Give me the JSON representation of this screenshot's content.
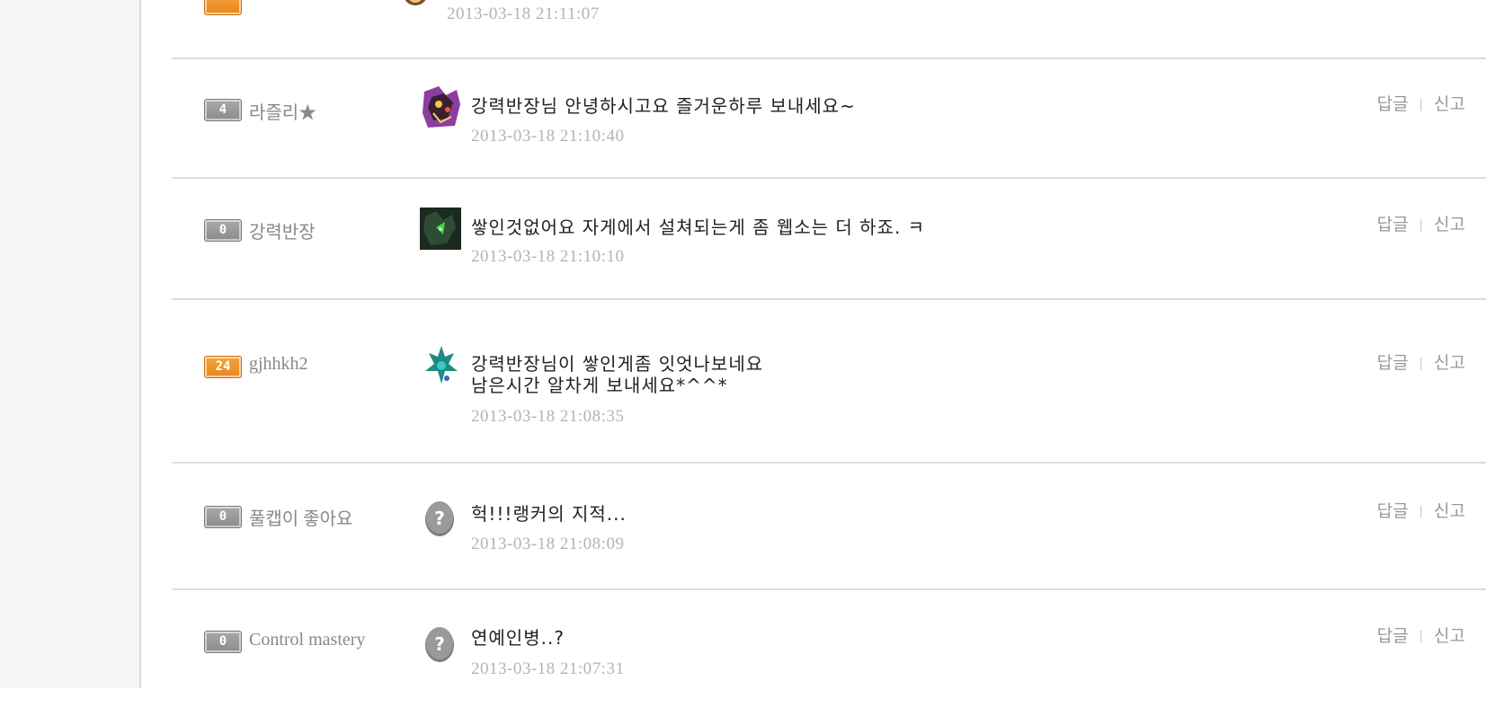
{
  "comments": [
    {
      "message": "",
      "timestamp": "2013-03-18 21:11:07"
    },
    {
      "level": "4",
      "nickname": "라즐리★",
      "message": "강력반장님 안녕하시고요 즐거운하루 보내세요~",
      "timestamp": "2013-03-18 21:10:40",
      "reply_label": "답글",
      "report_label": "신고"
    },
    {
      "level": "0",
      "nickname": "강력반장",
      "message": "쌓인것없어요 자게에서 설쳐되는게 좀 웹소는 더 하죠. ㅋ",
      "timestamp": "2013-03-18 21:10:10",
      "reply_label": "답글",
      "report_label": "신고"
    },
    {
      "level": "24",
      "nickname": "gjhhkh2",
      "message_line1": "강력반장님이 쌓인게좀 잇엇나보네요",
      "message_line2": "남은시간 알차게 보내세요*^^*",
      "timestamp": "2013-03-18 21:08:35",
      "reply_label": "답글",
      "report_label": "신고"
    },
    {
      "level": "0",
      "nickname": "풀캡이 좋아요",
      "message": "헉!!!랭커의 지적...",
      "timestamp": "2013-03-18 21:08:09",
      "reply_label": "답글",
      "report_label": "신고"
    },
    {
      "level": "0",
      "nickname": "Control mastery",
      "message": "연예인병..?",
      "timestamp": "2013-03-18 21:07:31",
      "reply_label": "답글",
      "report_label": "신고"
    }
  ],
  "actions_separator": "|",
  "colors": {
    "badge_gray": "#999999",
    "badge_orange": "#ee9127",
    "divider": "#dcdcdc",
    "timestamp": "#b3b3b3",
    "nickname": "#888888"
  }
}
